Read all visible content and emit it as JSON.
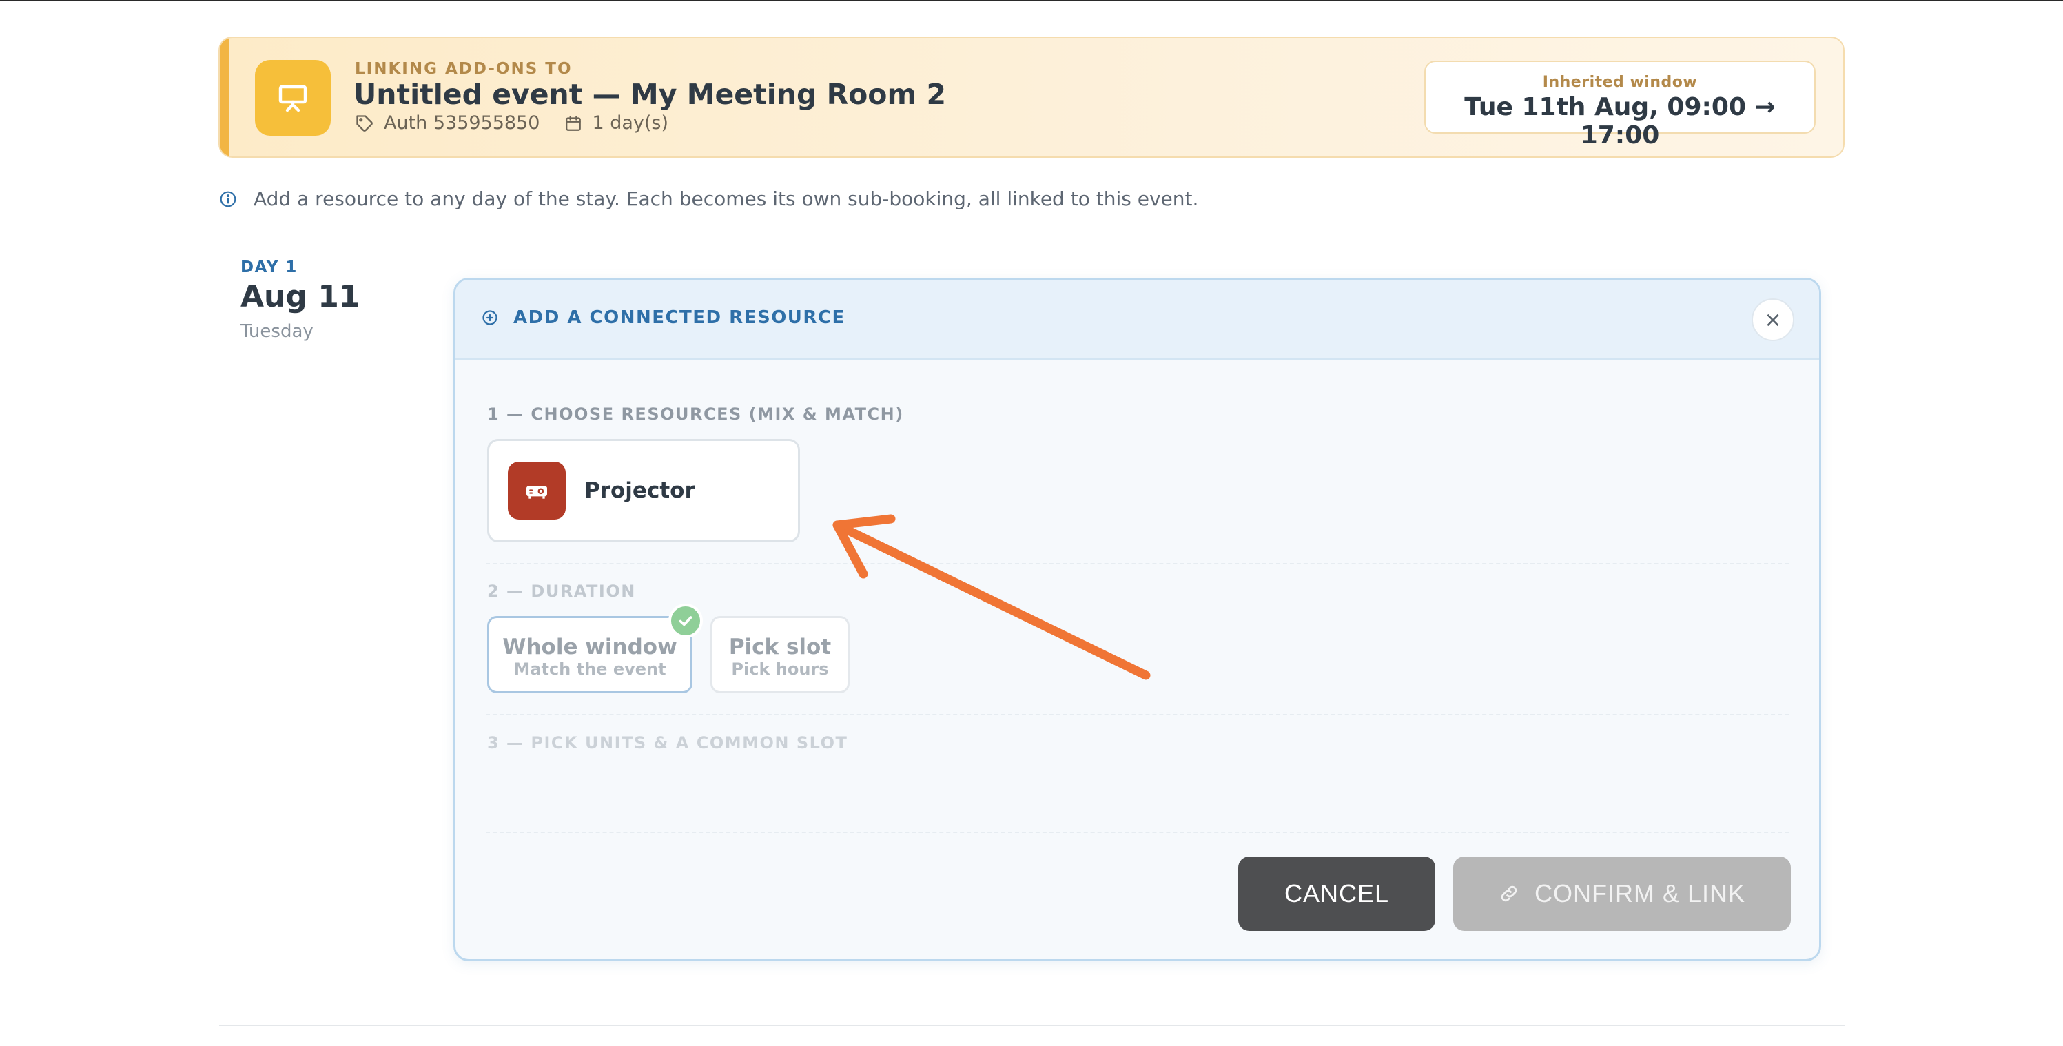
{
  "header": {
    "kicker": "LINKING ADD-ONS TO",
    "title": "Untitled event — My Meeting Room 2",
    "auth": "Auth 535955850",
    "days": "1 day(s)",
    "icon": "presentation-board-icon",
    "window_label": "Inherited window",
    "window_value": "Tue 11th Aug, 09:00 → 17:00"
  },
  "info": {
    "text": "Add a resource to any day of the stay. Each becomes its own sub-booking, all linked to this event."
  },
  "day": {
    "kicker": "DAY 1",
    "date": "Aug 11",
    "weekday": "Tuesday"
  },
  "panel": {
    "title": "ADD A CONNECTED RESOURCE",
    "close_label": "×",
    "step1_label": "1 — CHOOSE RESOURCES (MIX & MATCH)",
    "resources": [
      {
        "label": "Projector",
        "icon": "projector-icon",
        "color": "#b23b27"
      }
    ],
    "step2_label": "2 — DURATION",
    "duration_options": [
      {
        "title": "Whole window",
        "subtitle": "Match the event",
        "selected": true
      },
      {
        "title": "Pick slot",
        "subtitle": "Pick hours",
        "selected": false
      }
    ],
    "step3_label": "3 — PICK UNITS & A COMMON SLOT",
    "cancel_label": "CANCEL",
    "confirm_label": "CONFIRM & LINK"
  },
  "annotation": {
    "arrow_color": "#f07535"
  },
  "colors": {
    "accent": "#2e6fa8",
    "banner_bg": "#fdebc8",
    "banner_icon": "#f6bf3a",
    "success": "#8fcf98"
  }
}
